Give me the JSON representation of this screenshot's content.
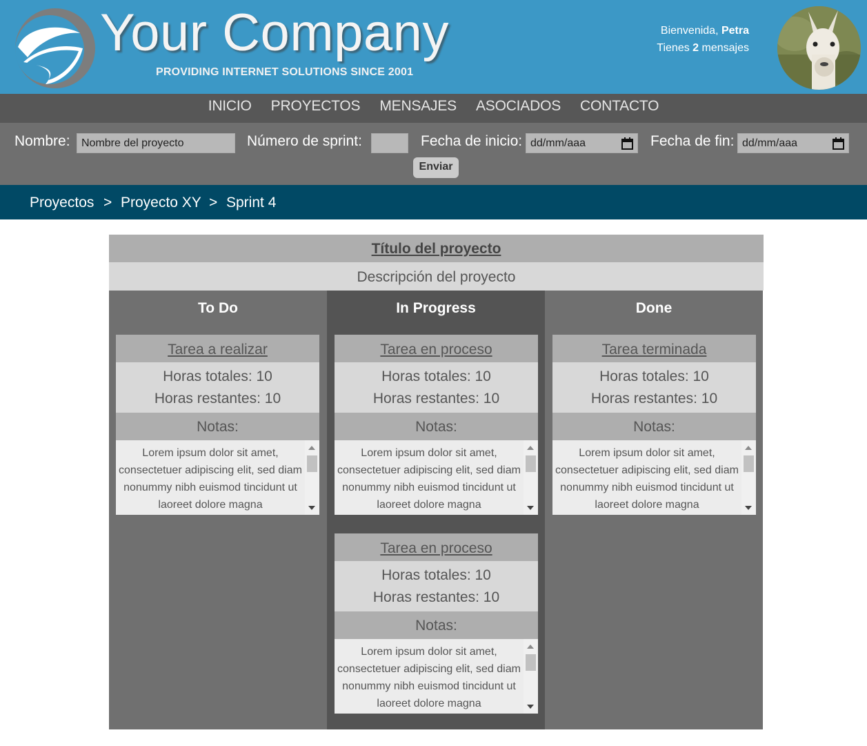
{
  "brand": {
    "title": "Your Company",
    "tagline": "PROVIDING INTERNET SOLUTIONS SINCE 2001",
    "color": "#3c98c6"
  },
  "user": {
    "welcome_prefix": "Bienvenida, ",
    "name": "Petra",
    "messages_prefix": "Tienes ",
    "messages_count": "2",
    "messages_suffix": " mensajes"
  },
  "nav": [
    "INICIO",
    "PROYECTOS",
    "MENSAJES",
    "ASOCIADOS",
    "CONTACTO"
  ],
  "form": {
    "name_label": "Nombre:",
    "name_placeholder": "Nombre del proyecto",
    "sprint_label": "Número de sprint:",
    "sprint_value": "",
    "start_label": "Fecha de inicio:",
    "start_placeholder": "dd/mm/aaa",
    "end_label": "Fecha de fin:",
    "end_placeholder": "dd/mm/aaa",
    "submit_label": "Enviar"
  },
  "breadcrumb": {
    "items": [
      "Proyectos",
      "Proyecto XY",
      "Sprint 4"
    ],
    "separator": ">"
  },
  "project": {
    "title": "Título del proyecto",
    "description": "Descripción del proyecto"
  },
  "columns": [
    {
      "name": "To Do",
      "cards": [
        {
          "title": "Tarea a realizar",
          "total": "Horas totales: 10",
          "remaining": "Horas restantes: 10",
          "notes_label": "Notas:",
          "notes": "Lorem ipsum dolor sit amet, consectetuer adipiscing elit, sed diam nonummy nibh euismod tincidunt ut laoreet dolore magna"
        }
      ]
    },
    {
      "name": "In Progress",
      "cards": [
        {
          "title": "Tarea en proceso",
          "total": "Horas totales: 10",
          "remaining": "Horas restantes: 10",
          "notes_label": "Notas:",
          "notes": "Lorem ipsum dolor sit amet, consectetuer adipiscing elit, sed diam nonummy nibh euismod tincidunt ut laoreet dolore magna"
        },
        {
          "title": "Tarea en proceso",
          "total": "Horas totales: 10",
          "remaining": "Horas restantes: 10",
          "notes_label": "Notas:",
          "notes": "Lorem ipsum dolor sit amet, consectetuer adipiscing elit, sed diam nonummy nibh euismod tincidunt ut laoreet dolore magna"
        }
      ]
    },
    {
      "name": "Done",
      "cards": [
        {
          "title": "Tarea terminada",
          "total": "Horas totales: 10",
          "remaining": "Horas restantes: 10",
          "notes_label": "Notas:",
          "notes": "Lorem ipsum dolor sit amet, consectetuer adipiscing elit, sed diam nonummy nibh euismod tincidunt ut laoreet dolore magna"
        }
      ]
    }
  ]
}
